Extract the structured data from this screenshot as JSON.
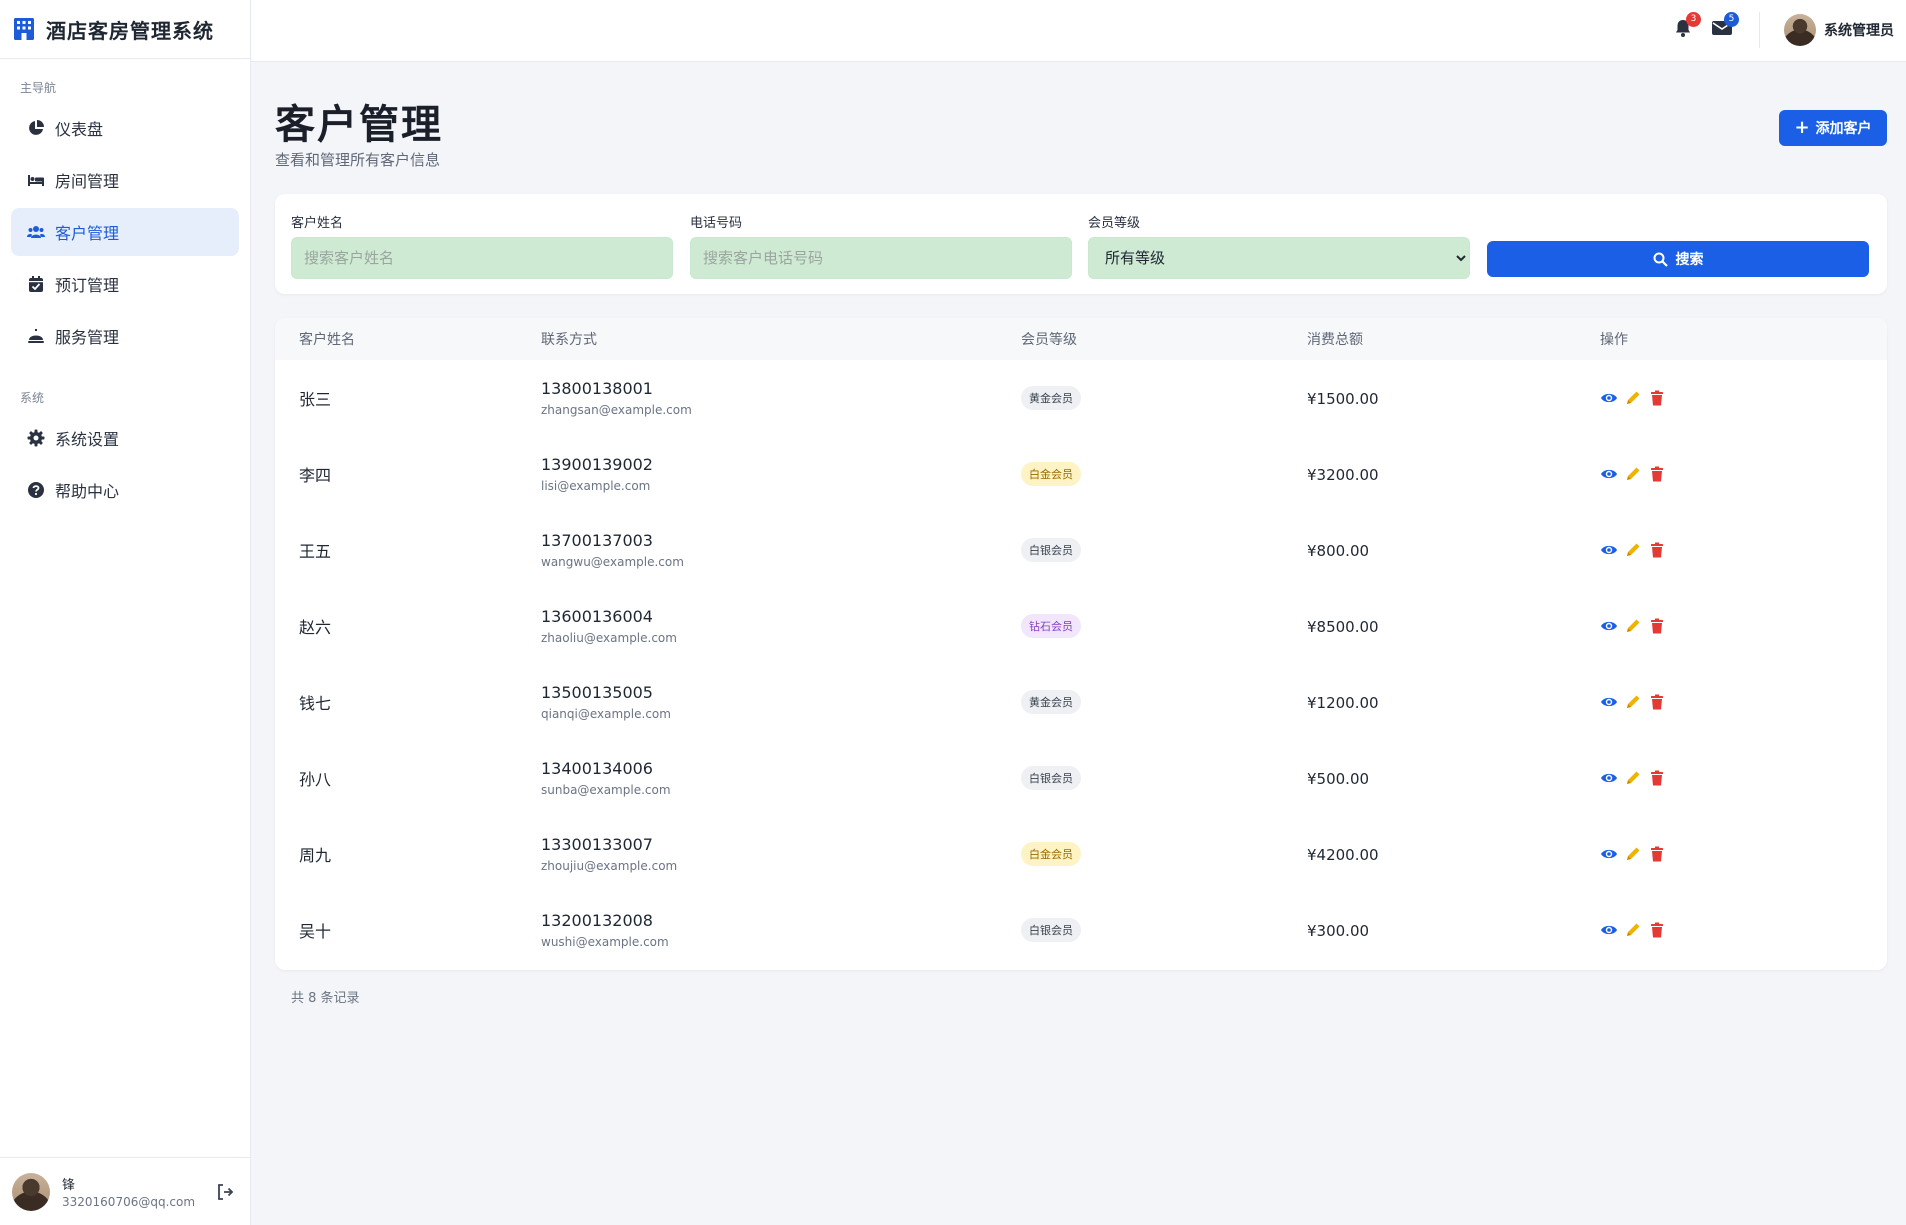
{
  "brand": {
    "title": "酒店客房管理系统"
  },
  "sidebar": {
    "group_main": "主导航",
    "group_system": "系统",
    "main_items": [
      {
        "label": "仪表盘",
        "icon": "chart-pie-icon"
      },
      {
        "label": "房间管理",
        "icon": "bed-icon"
      },
      {
        "label": "客户管理",
        "icon": "users-icon",
        "active": true
      },
      {
        "label": "预订管理",
        "icon": "calendar-check-icon"
      },
      {
        "label": "服务管理",
        "icon": "bell-concierge-icon"
      }
    ],
    "system_items": [
      {
        "label": "系统设置",
        "icon": "gear-icon"
      },
      {
        "label": "帮助中心",
        "icon": "question-circle-icon"
      }
    ],
    "footer": {
      "name": "锋",
      "email": "3320160706@qq.com"
    }
  },
  "topbar": {
    "notifications_count": "3",
    "messages_count": "5",
    "user_name": "系统管理员"
  },
  "page": {
    "title": "客户管理",
    "subtitle": "查看和管理所有客户信息",
    "add_button": "添加客户"
  },
  "filters": {
    "name_label": "客户姓名",
    "name_placeholder": "搜索客户姓名",
    "phone_label": "电话号码",
    "phone_placeholder": "搜索客户电话号码",
    "level_label": "会员等级",
    "level_selected": "所有等级",
    "search_button": "搜索"
  },
  "table": {
    "headers": [
      "客户姓名",
      "联系方式",
      "会员等级",
      "消费总额",
      "操作"
    ],
    "rows": [
      {
        "name": "张三",
        "phone": "13800138001",
        "email": "zhangsan@example.com",
        "level": "黄金会员",
        "total": "¥1500.00"
      },
      {
        "name": "李四",
        "phone": "13900139002",
        "email": "lisi@example.com",
        "level": "白金会员",
        "total": "¥3200.00"
      },
      {
        "name": "王五",
        "phone": "13700137003",
        "email": "wangwu@example.com",
        "level": "白银会员",
        "total": "¥800.00"
      },
      {
        "name": "赵六",
        "phone": "13600136004",
        "email": "zhaoliu@example.com",
        "level": "钻石会员",
        "total": "¥8500.00"
      },
      {
        "name": "钱七",
        "phone": "13500135005",
        "email": "qianqi@example.com",
        "level": "黄金会员",
        "total": "¥1200.00"
      },
      {
        "name": "孙八",
        "phone": "13400134006",
        "email": "sunba@example.com",
        "level": "白银会员",
        "total": "¥500.00"
      },
      {
        "name": "周九",
        "phone": "13300133007",
        "email": "zhoujiu@example.com",
        "level": "白金会员",
        "total": "¥4200.00"
      },
      {
        "name": "吴十",
        "phone": "13200132008",
        "email": "wushi@example.com",
        "level": "白银会员",
        "total": "¥300.00"
      }
    ],
    "footer": "共 8 条记录"
  },
  "colors": {
    "accent": "#1a5fe6",
    "level_styles": {
      "黄金会员": {
        "bg": "#eef0f3",
        "fg": "#3b4250"
      },
      "白金会员": {
        "bg": "#fdf3c4",
        "fg": "#9a6a00"
      },
      "白银会员": {
        "bg": "#eef0f3",
        "fg": "#3b4250"
      },
      "钻石会员": {
        "bg": "#f1e6fb",
        "fg": "#8a3fc2"
      }
    },
    "op_view": "#1a5fe6",
    "op_edit": "#f0b400",
    "op_delete": "#e53935"
  }
}
